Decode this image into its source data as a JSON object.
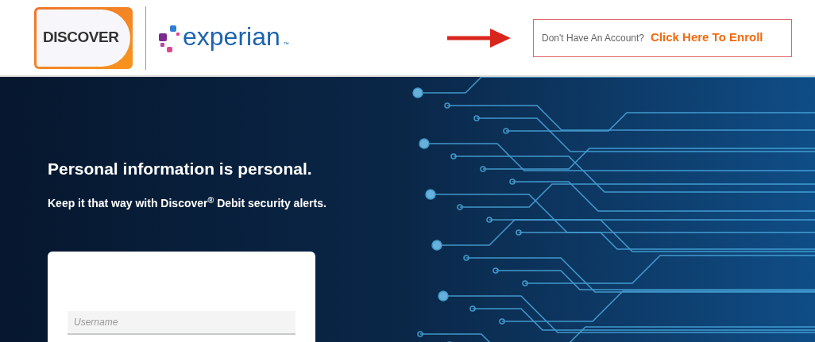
{
  "header": {
    "logos": {
      "discover": "DISCOVER",
      "experian": "experian",
      "experian_mark": "™"
    },
    "enroll": {
      "prompt": "Don't Have An Account?",
      "link": "Click Here To Enroll"
    }
  },
  "hero": {
    "title": "Personal information is personal.",
    "subtitle": "Keep it that way with Discover$^{®}$ Debit security alerts."
  },
  "login": {
    "username": {
      "placeholder": "Username"
    }
  }
}
